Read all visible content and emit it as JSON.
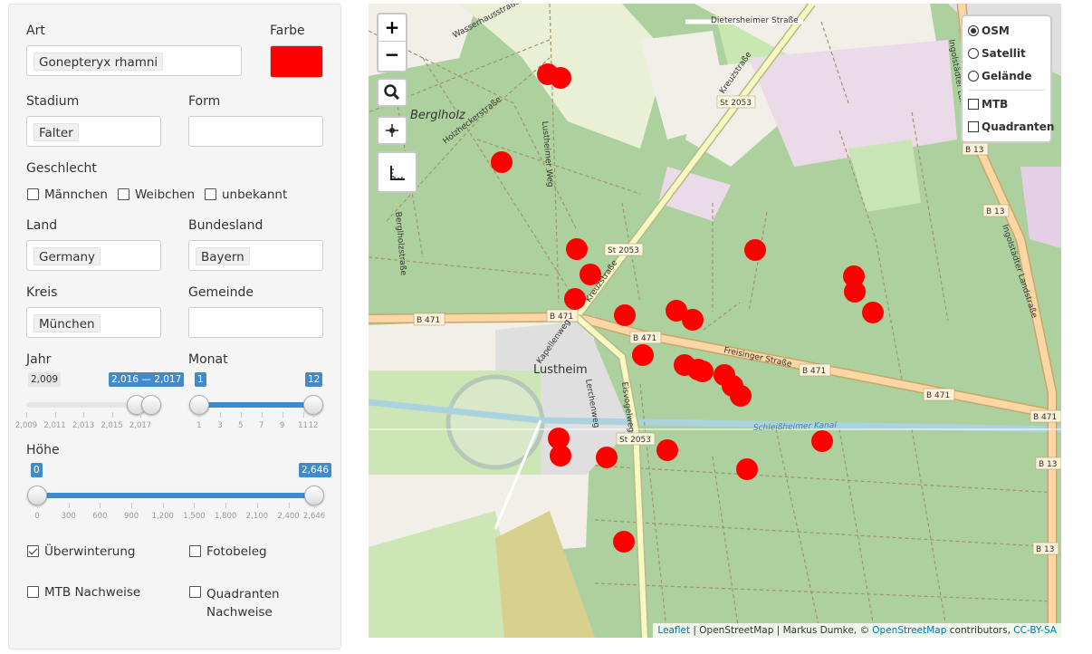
{
  "form": {
    "art": {
      "label": "Art",
      "value": "Gonepteryx rhamni"
    },
    "farbe": {
      "label": "Farbe",
      "color": "#ff0000"
    },
    "stadium": {
      "label": "Stadium",
      "value": "Falter"
    },
    "form": {
      "label": "Form",
      "value": ""
    },
    "geschlecht": {
      "label": "Geschlecht",
      "options": [
        {
          "label": "Männchen",
          "checked": false
        },
        {
          "label": "Weibchen",
          "checked": false
        },
        {
          "label": "unbekannt",
          "checked": false
        }
      ]
    },
    "land": {
      "label": "Land",
      "value": "Germany"
    },
    "bundesland": {
      "label": "Bundesland",
      "value": "Bayern"
    },
    "kreis": {
      "label": "Kreis",
      "value": "München"
    },
    "gemeinde": {
      "label": "Gemeinde",
      "value": ""
    },
    "jahr": {
      "label": "Jahr",
      "min_label": "2,009",
      "range_label": "2,016 — 2,017",
      "min": 2009,
      "max": 2017,
      "from": 2016,
      "to": 2017,
      "ticks": [
        "2,009",
        "2,011",
        "2,013",
        "2,015",
        "2,017"
      ]
    },
    "monat": {
      "label": "Monat",
      "from_label": "1",
      "to_label": "12",
      "min": 1,
      "max": 12,
      "from": 1,
      "to": 12,
      "ticks": [
        "1",
        "3",
        "5",
        "7",
        "9",
        "11",
        "12"
      ]
    },
    "hoehe": {
      "label": "Höhe",
      "from_label": "0",
      "to_label": "2,646",
      "min": 0,
      "max": 2646,
      "from": 0,
      "to": 2646,
      "ticks": [
        "0",
        "300",
        "600",
        "900",
        "1,200",
        "1,500",
        "1,800",
        "2,100",
        "2,400",
        "2,646"
      ]
    },
    "checks": {
      "ueberwinterung": {
        "label": "Überwinterung",
        "checked": true
      },
      "fotobeleg": {
        "label": "Fotobeleg",
        "checked": false
      },
      "mtb_nachweise": {
        "label": "MTB Nachweise",
        "checked": false
      },
      "quadranten_nachweise": {
        "label": "Quadranten Nachweise",
        "checked": false
      }
    }
  },
  "map": {
    "zoom_in": "+",
    "zoom_out": "−",
    "layers": {
      "base": [
        {
          "label": "OSM",
          "selected": true
        },
        {
          "label": "Satellit",
          "selected": false
        },
        {
          "label": "Gelände",
          "selected": false
        }
      ],
      "overlays": [
        {
          "label": "MTB",
          "checked": false
        },
        {
          "label": "Quadranten",
          "checked": false
        }
      ]
    },
    "places": {
      "berglholz": "Berglholz",
      "lustheim": "Lustheim"
    },
    "roads": {
      "b471_1": "B 471",
      "b471_2": "B 471",
      "b471_3": "B 471",
      "b471_4": "B 471",
      "b471_5": "B 471",
      "b471_6": "B 471",
      "st2053_1": "St 2053",
      "st2053_2": "St 2053",
      "st2053_3": "St 2053",
      "b13_1": "B 13",
      "b13_2": "B 13",
      "b13_3": "B 13",
      "b13_4": "B 13",
      "kreuzstrasse_1": "Kreuzstraße",
      "kreuzstrasse_2": "Kreuzstraße",
      "freisinger": "Freisinger Straße",
      "ingolstaedter_1": "Ingolstädter Landstraße",
      "ingolstaedter_2": "Ingolstädter Landstraße",
      "dietersheimer": "Dietersheimer Straße",
      "kanal": "Schleißheimer Kanal",
      "wasserhaus": "Wasserhausstraße",
      "holzhecker": "Holzheckerstraße",
      "lustheimer_weg": "Lustheimer Weg",
      "kapellenweg": "Kapellenweg",
      "lerchenweg": "Lerchenweg",
      "eisvogelweg": "Eisvogelweg",
      "berglholzstr": "Berglholzstraße"
    },
    "attribution": {
      "leaflet": "Leaflet",
      "text1": " | OpenStreetMap | Markus Dumke, © ",
      "osm": "OpenStreetMap",
      "text2": " contributors, ",
      "license": "CC-BY-SA"
    },
    "marker_count": 27
  }
}
